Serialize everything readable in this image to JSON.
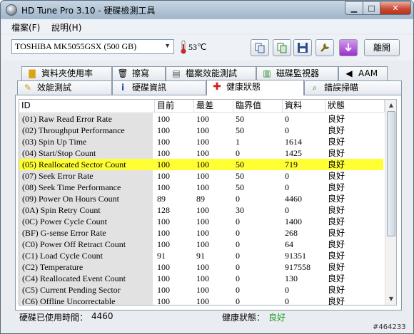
{
  "window": {
    "title": "HD Tune Pro 3.10 - 硬碟檢測工具"
  },
  "menu": {
    "file": "檔案(F)",
    "help": "說明(H)"
  },
  "toolbar": {
    "drive": "TOSHIBA MK5055GSX (500 GB)",
    "temperature": "53℃",
    "exit_label": "離開"
  },
  "tabs_row1": [
    {
      "label": "資料夾使用率",
      "icon": "folder-icon"
    },
    {
      "label": "擦寫",
      "icon": "trash-icon"
    },
    {
      "label": "檔案效能測試",
      "icon": "file-benchmark-icon"
    },
    {
      "label": "磁碟監視器",
      "icon": "monitor-chart-icon"
    },
    {
      "label": "AAM",
      "icon": "speaker-icon"
    }
  ],
  "tabs_row2": [
    {
      "label": "效能測試",
      "icon": "benchmark-icon"
    },
    {
      "label": "硬碟資訊",
      "icon": "info-icon"
    },
    {
      "label": "健康狀態",
      "icon": "health-cross-icon"
    },
    {
      "label": "錯誤掃瞄",
      "icon": "error-scan-icon"
    }
  ],
  "grid": {
    "headers": [
      "ID",
      "目前",
      "最差",
      "臨界值",
      "資料",
      "狀態"
    ],
    "rows": [
      [
        "(01) Raw Read Error Rate",
        "100",
        "100",
        "50",
        "0",
        "良好"
      ],
      [
        "(02) Throughput Performance",
        "100",
        "100",
        "50",
        "0",
        "良好"
      ],
      [
        "(03) Spin Up Time",
        "100",
        "100",
        "1",
        "1614",
        "良好"
      ],
      [
        "(04) Start/Stop Count",
        "100",
        "100",
        "0",
        "1425",
        "良好"
      ],
      [
        "(05) Reallocated Sector Count",
        "100",
        "100",
        "50",
        "719",
        "良好"
      ],
      [
        "(07) Seek Error Rate",
        "100",
        "100",
        "50",
        "0",
        "良好"
      ],
      [
        "(08) Seek Time Performance",
        "100",
        "100",
        "50",
        "0",
        "良好"
      ],
      [
        "(09) Power On Hours Count",
        "89",
        "89",
        "0",
        "4460",
        "良好"
      ],
      [
        "(0A) Spin Retry Count",
        "128",
        "100",
        "30",
        "0",
        "良好"
      ],
      [
        "(0C) Power Cycle Count",
        "100",
        "100",
        "0",
        "1400",
        "良好"
      ],
      [
        "(BF) G-sense Error Rate",
        "100",
        "100",
        "0",
        "268",
        "良好"
      ],
      [
        "(C0) Power Off Retract Count",
        "100",
        "100",
        "0",
        "64",
        "良好"
      ],
      [
        "(C1) Load Cycle Count",
        "91",
        "91",
        "0",
        "91351",
        "良好"
      ],
      [
        "(C2) Temperature",
        "100",
        "100",
        "0",
        "917558",
        "良好"
      ],
      [
        "(C4) Reallocated Event Count",
        "100",
        "100",
        "0",
        "130",
        "良好"
      ],
      [
        "(C5) Current Pending Sector",
        "100",
        "100",
        "0",
        "0",
        "良好"
      ],
      [
        "(C6) Offline Uncorrectable",
        "100",
        "100",
        "0",
        "0",
        "良好"
      ]
    ],
    "highlighted_row": 4
  },
  "status": {
    "hours_label": "硬碟已使用時間：",
    "hours_value": "4460",
    "health_label": "健康狀態：",
    "health_value": "良好"
  },
  "watermark": "#464233",
  "colors": {
    "highlight": "#ffff33",
    "health_good": "#1a9a1a"
  }
}
